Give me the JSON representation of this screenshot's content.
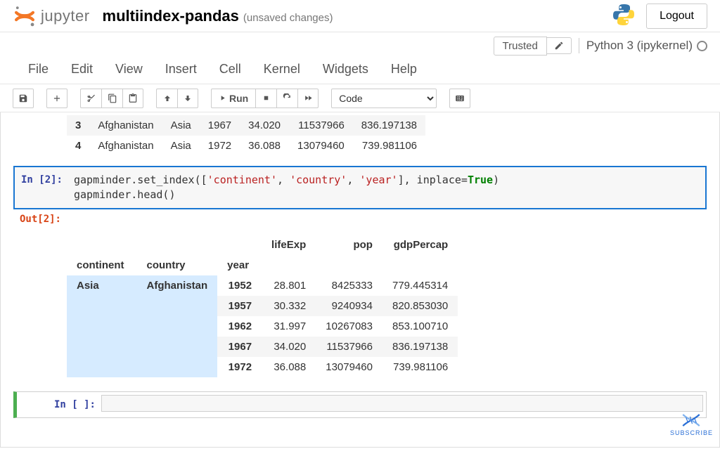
{
  "header": {
    "brand": "jupyter",
    "notebook_title": "multiindex-pandas",
    "unsaved_label": "(unsaved changes)",
    "logout_label": "Logout"
  },
  "kernel_row": {
    "trusted_label": "Trusted",
    "kernel_name": "Python 3 (ipykernel)"
  },
  "menu": {
    "file": "File",
    "edit": "Edit",
    "view": "View",
    "insert": "Insert",
    "cell": "Cell",
    "kernel": "Kernel",
    "widgets": "Widgets",
    "help": "Help"
  },
  "toolbar": {
    "run_label": "Run",
    "cell_type_selected": "Code"
  },
  "top_table": {
    "rows": [
      {
        "idx": "3",
        "country": "Afghanistan",
        "continent": "Asia",
        "year": "1967",
        "lifeExp": "34.020",
        "pop": "11537966",
        "gdpPercap": "836.197138"
      },
      {
        "idx": "4",
        "country": "Afghanistan",
        "continent": "Asia",
        "year": "1972",
        "lifeExp": "36.088",
        "pop": "13079460",
        "gdpPercap": "739.981106"
      }
    ]
  },
  "cell2": {
    "in_label": "In [2]:",
    "out_label": "Out[2]:",
    "code_pre": "gapminder.set_index([",
    "code_s1": "'continent'",
    "code_sep1": ", ",
    "code_s2": "'country'",
    "code_sep2": ", ",
    "code_s3": "'year'",
    "code_post": "], inplace=",
    "code_kw": "True",
    "code_tail": ")",
    "code_line2": "gapminder.head()"
  },
  "mi": {
    "columns": {
      "lifeExp": "lifeExp",
      "pop": "pop",
      "gdpPercap": "gdpPercap"
    },
    "index_names": {
      "continent": "continent",
      "country": "country",
      "year": "year"
    },
    "continent": "Asia",
    "country": "Afghanistan",
    "rows": [
      {
        "year": "1952",
        "lifeExp": "28.801",
        "pop": "8425333",
        "gdpPercap": "779.445314"
      },
      {
        "year": "1957",
        "lifeExp": "30.332",
        "pop": "9240934",
        "gdpPercap": "820.853030"
      },
      {
        "year": "1962",
        "lifeExp": "31.997",
        "pop": "10267083",
        "gdpPercap": "853.100710"
      },
      {
        "year": "1967",
        "lifeExp": "34.020",
        "pop": "11537966",
        "gdpPercap": "836.197138"
      },
      {
        "year": "1972",
        "lifeExp": "36.088",
        "pop": "13079460",
        "gdpPercap": "739.981106"
      }
    ]
  },
  "empty_cell": {
    "prompt": "In [ ]:"
  },
  "subscribe": {
    "label": "SUBSCRIBE"
  }
}
